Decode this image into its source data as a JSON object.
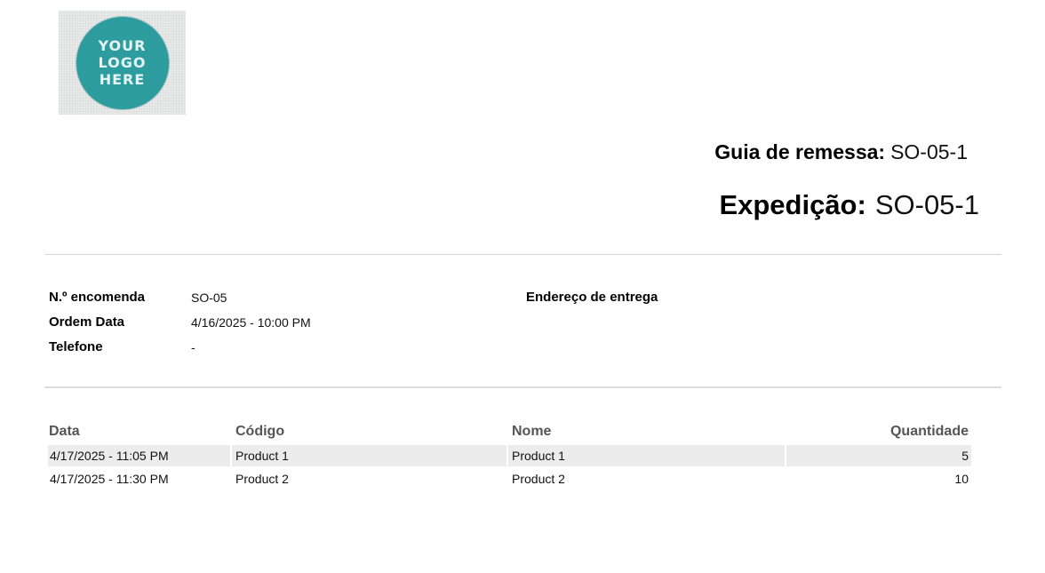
{
  "logo": {
    "lines": [
      "YOUR",
      "LOGO",
      "HERE"
    ],
    "color": "#2c9c9f"
  },
  "header": {
    "delivery_note_label": "Guia de remessa:",
    "delivery_note_value": "SO-05-1",
    "shipment_label": "Expedição:",
    "shipment_value": "SO-05-1"
  },
  "order_info": {
    "order_number_label": "N.º encomenda",
    "order_number_value": "SO-05",
    "order_date_label": "Ordem Data",
    "order_date_value": "4/16/2025 - 10:00 PM",
    "phone_label": "Telefone",
    "phone_value": "-",
    "delivery_address_label": "Endereço de entrega"
  },
  "table": {
    "columns": [
      "Data",
      "Código",
      "Nome",
      "Quantidade"
    ],
    "rows": [
      [
        "4/17/2025 - 11:05 PM",
        "Product 1",
        "Product 1",
        "5"
      ],
      [
        "4/17/2025 - 11:30 PM",
        "Product 2",
        "Product 2",
        "10"
      ]
    ],
    "header_color": "#555555",
    "stripe_color": "#ececec"
  }
}
